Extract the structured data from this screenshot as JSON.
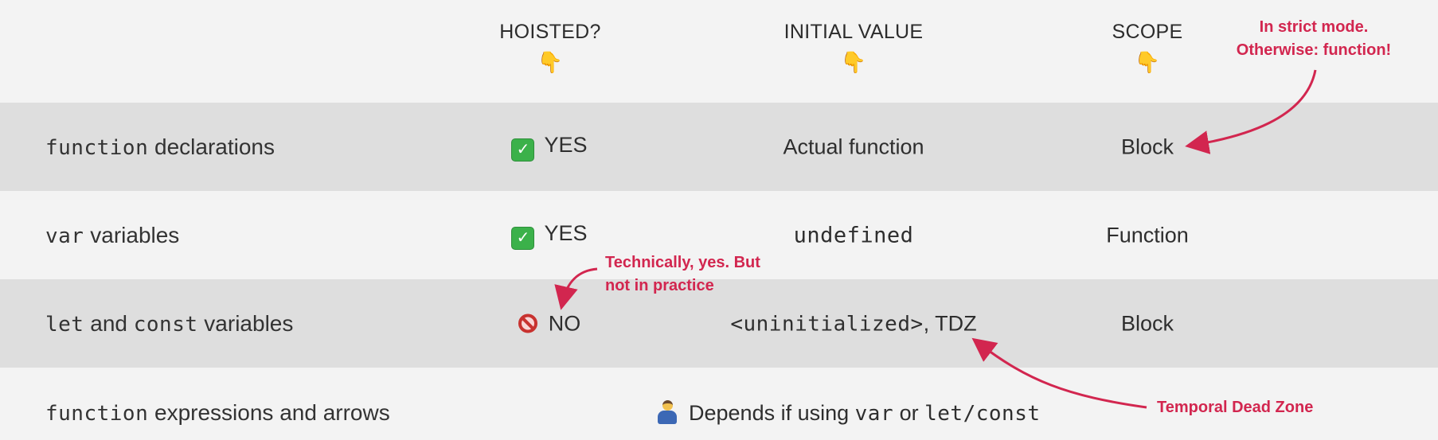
{
  "header": {
    "hoisted": "HOISTED?",
    "initial_value": "INITIAL VALUE",
    "scope": "SCOPE",
    "pointer_glyph": "👇"
  },
  "rows": [
    {
      "code": "function",
      "label_rest": " declarations",
      "hoisted": "YES",
      "hoisted_icon": "check-icon",
      "initial_value": "Actual function",
      "scope": "Block"
    },
    {
      "code": "var",
      "label_rest": " variables",
      "hoisted": "YES",
      "hoisted_icon": "check-icon",
      "initial_value": "undefined",
      "scope": "Function"
    },
    {
      "code": "let",
      "label_mid": " and ",
      "code2": "const",
      "label_rest": " variables",
      "hoisted": "NO",
      "hoisted_icon": "no-entry-icon",
      "initial_value_code": "<uninitialized>",
      "initial_value_rest": ", TDZ",
      "scope": "Block"
    },
    {
      "code": "function",
      "label_rest": " expressions and arrows",
      "depends_text": "Depends if using ",
      "depends_code1": "var",
      "depends_mid": " or ",
      "depends_code2": "let/const",
      "depends_icon": "shrug-icon"
    }
  ],
  "annotations": {
    "strict_mode_line1": "In strict mode.",
    "strict_mode_line2": "Otherwise: function!",
    "technically_line1": "Technically, yes. But",
    "technically_line2": "not in practice",
    "tdz": "Temporal Dead Zone"
  },
  "colors": {
    "background": "#f3f3f3",
    "shaded_row": "#dedede",
    "annotation": "#d2264f",
    "check_green": "#3bb14a"
  }
}
